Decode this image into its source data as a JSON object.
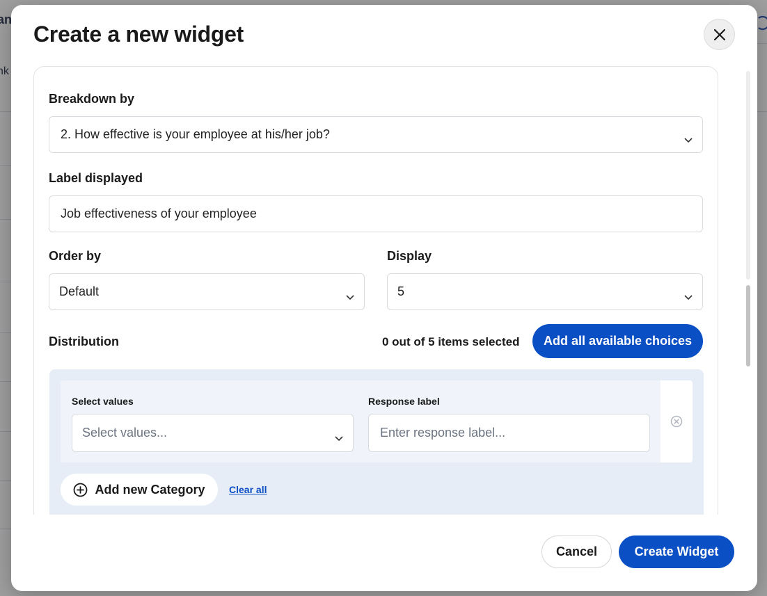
{
  "background": {
    "frag_1": "an",
    "frag_2": "nk"
  },
  "modal": {
    "title": "Create a new widget",
    "close_icon": "close-icon"
  },
  "form": {
    "breakdown": {
      "label": "Breakdown by",
      "value": "2. How effective is your employee at his/her job?"
    },
    "label_displayed": {
      "label": "Label displayed",
      "value": "Job effectiveness of your employee"
    },
    "order_by": {
      "label": "Order by",
      "value": "Default"
    },
    "display": {
      "label": "Display",
      "value": "5"
    },
    "distribution": {
      "label": "Distribution",
      "count_text": "0 out of 5 items selected",
      "add_all_label": "Add all available choices",
      "row": {
        "select_values_label": "Select values",
        "select_values_placeholder": "Select values...",
        "response_label_label": "Response label",
        "response_label_placeholder": "Enter response label..."
      },
      "add_category_label": "Add new Category",
      "clear_all_label": "Clear all"
    }
  },
  "footer": {
    "cancel_label": "Cancel",
    "create_label": "Create Widget"
  },
  "colors": {
    "primary": "#0a4fc4",
    "panel": "#e6edf7"
  }
}
